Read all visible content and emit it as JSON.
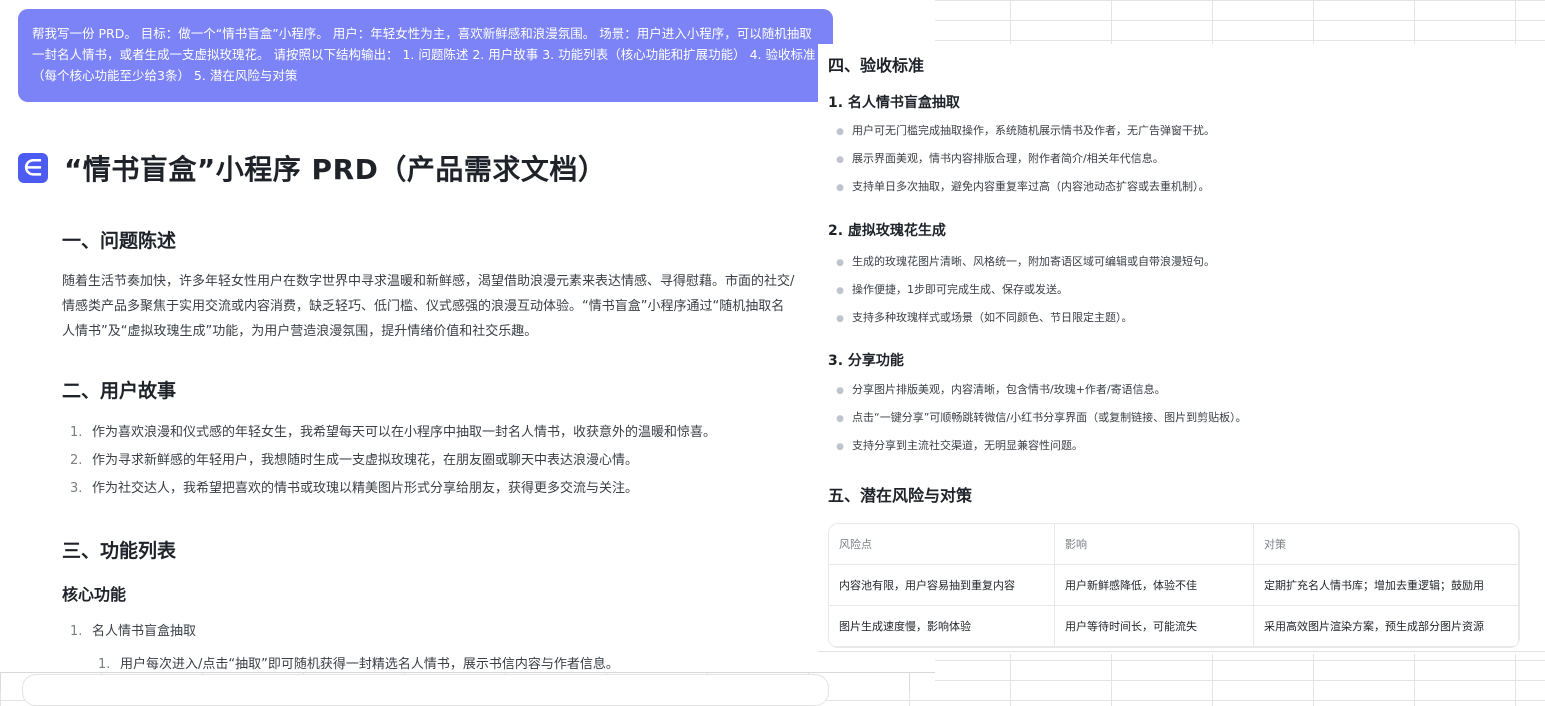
{
  "prompt_text": "帮我写一份 PRD。 目标：做一个“情书盲盒”小程序。 用户：年轻女性为主，喜欢新鲜感和浪漫氛围。 场景：用户进入小程序，可以随机抽取一封名人情书，或者生成一支虚拟玫瑰花。 请按照以下结构输出： 1. 问题陈述 2. 用户故事 3. 功能列表（核心功能和扩展功能） 4. 验收标准（每个核心功能至少给3条） 5. 潜在风险与对策",
  "logo_letter": "∈",
  "doc_title": "“情书盲盒”小程序 PRD（产品需求文档）",
  "section1": {
    "title": "一、问题陈述",
    "body": "随着生活节奏加快，许多年轻女性用户在数字世界中寻求温暖和新鲜感，渴望借助浪漫元素来表达情感、寻得慰藉。市面的社交/情感类产品多聚焦于实用交流或内容消费，缺乏轻巧、低门槛、仪式感强的浪漫互动体验。“情书盲盒”小程序通过“随机抽取名人情书”及“虚拟玫瑰生成”功能，为用户营造浪漫氛围，提升情绪价值和社交乐趣。"
  },
  "section2": {
    "title": "二、用户故事",
    "items": [
      {
        "num": "1.",
        "text": "作为喜欢浪漫和仪式感的年轻女生，我希望每天可以在小程序中抽取一封名人情书，收获意外的温暖和惊喜。"
      },
      {
        "num": "2.",
        "text": "作为寻求新鲜感的年轻用户，我想随时生成一支虚拟玫瑰花，在朋友圈或聊天中表达浪漫心情。"
      },
      {
        "num": "3.",
        "text": "作为社交达人，我希望把喜欢的情书或玫瑰以精美图片形式分享给朋友，获得更多交流与关注。"
      }
    ]
  },
  "section3": {
    "title": "三、功能列表",
    "core_title": "核心功能",
    "item1": {
      "num": "1.",
      "text": "名人情书盲盒抽取"
    },
    "item1_sub": {
      "num": "1.",
      "text": "用户每次进入/点击“抽取”即可随机获得一封精选名人情书，展示书信内容与作者信息。"
    }
  },
  "section4": {
    "title": "四、验收标准",
    "groups": [
      {
        "title": "1. 名人情书盲盒抽取",
        "items": [
          "用户可无门槛完成抽取操作，系统随机展示情书及作者，无广告弹窗干扰。",
          "展示界面美观，情书内容排版合理，附作者简介/相关年代信息。",
          "支持单日多次抽取，避免内容重复率过高（内容池动态扩容或去重机制）。"
        ]
      },
      {
        "title": "2. 虚拟玫瑰花生成",
        "items": [
          "生成的玫瑰花图片清晰、风格统一，附加寄语区域可编辑或自带浪漫短句。",
          "操作便捷，1步即可完成生成、保存或发送。",
          "支持多种玫瑰样式或场景（如不同颜色、节日限定主题）。"
        ]
      },
      {
        "title": "3. 分享功能",
        "items": [
          "分享图片排版美观，内容清晰，包含情书/玫瑰+作者/寄语信息。",
          "点击“一键分享”可顺畅跳转微信/小红书分享界面（或复制链接、图片到剪贴板）。",
          "支持分享到主流社交渠道，无明显兼容性问题。"
        ]
      }
    ]
  },
  "section5": {
    "title": "五、潜在风险与对策",
    "headers": [
      "风险点",
      "影响",
      "对策"
    ],
    "rows": [
      [
        "内容池有限，用户容易抽到重复内容",
        "用户新鲜感降低，体验不佳",
        "定期扩充名人情书库；增加去重逻辑；鼓励用"
      ],
      [
        "图片生成速度慢，影响体验",
        "用户等待时间长，可能流失",
        "采用高效图片渲染方案，预生成部分图片资源"
      ]
    ]
  }
}
